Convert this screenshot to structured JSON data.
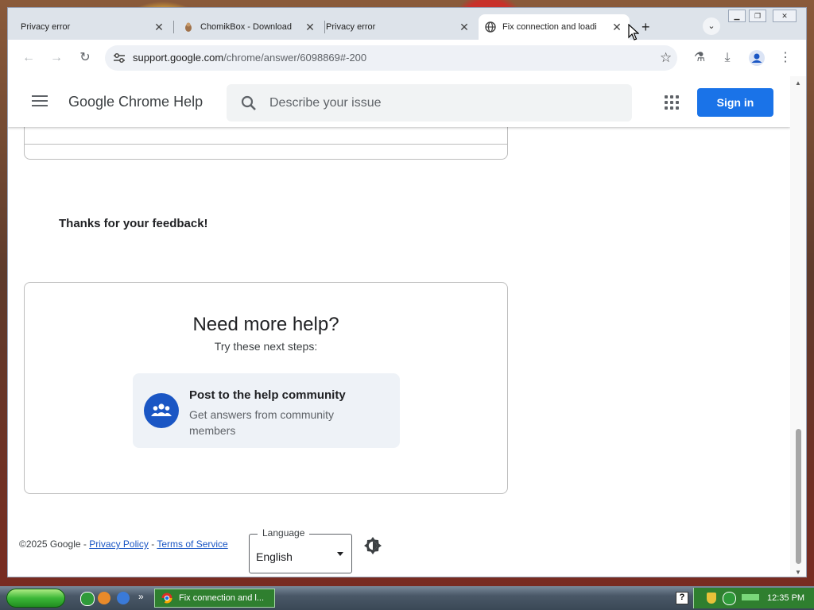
{
  "tabs": [
    {
      "title": "Privacy error",
      "active": false
    },
    {
      "title": "ChomikBox - Download",
      "active": false
    },
    {
      "title": "Privacy error",
      "active": false
    },
    {
      "title": "Fix connection and loadi",
      "active": true
    }
  ],
  "toolbar": {
    "url_host": "support.google.com",
    "url_path": "/chrome/answer/6098869#-200"
  },
  "header": {
    "title": "Google Chrome Help",
    "search_placeholder": "Describe your issue",
    "signin_label": "Sign in"
  },
  "feedback": {
    "message": "Thanks for your feedback!"
  },
  "help": {
    "heading": "Need more help?",
    "subheading": "Try these next steps:",
    "community_title": "Post to the help community",
    "community_subtitle": "Get answers from community members"
  },
  "footer": {
    "copyright": "©2025 Google - ",
    "privacy": "Privacy Policy",
    "separator": " - ",
    "terms": "Terms of Service",
    "language_label": "Language",
    "language_value": "English"
  },
  "taskbar": {
    "task_title": "Fix connection and l...",
    "clock": "12:35 PM"
  },
  "colors": {
    "accent": "#1a73e8",
    "community_icon": "#1a56c4"
  }
}
